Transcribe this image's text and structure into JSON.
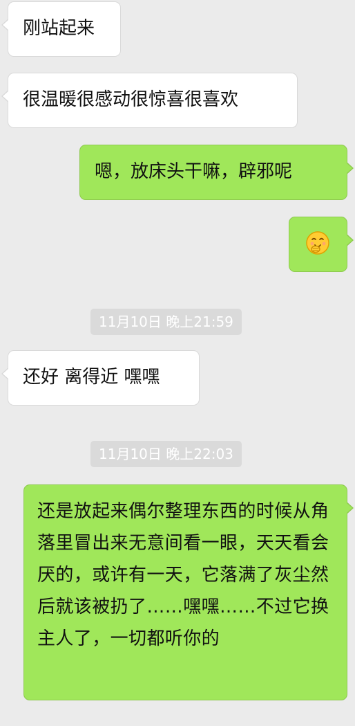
{
  "messages": [
    {
      "side": "in",
      "text": "刚站起来"
    },
    {
      "side": "in",
      "text": "很温暖很感动很惊喜很喜欢"
    },
    {
      "side": "out",
      "text": "嗯，放床头干嘛，辟邪呢"
    },
    {
      "side": "out",
      "emoji": "giggle-face-emoji"
    },
    {
      "side": "in",
      "text": "还好 离得近 嘿嘿"
    },
    {
      "side": "out",
      "text": "还是放起来偶尔整理东西的时候从角落里冒出来无意间看一眼，天天看会厌的，或许有一天，它落满了灰尘然后就该被扔了……嘿嘿……不过它换主人了，一切都听你的"
    }
  ],
  "timestamps": [
    "11月10日 晚上21:59",
    "11月10日 晚上22:03"
  ],
  "colors": {
    "background": "#ebebeb",
    "incoming_bubble": "#ffffff",
    "outgoing_bubble": "#a0e75a",
    "timestamp_bg": "#dadada",
    "timestamp_text": "#ffffff"
  }
}
